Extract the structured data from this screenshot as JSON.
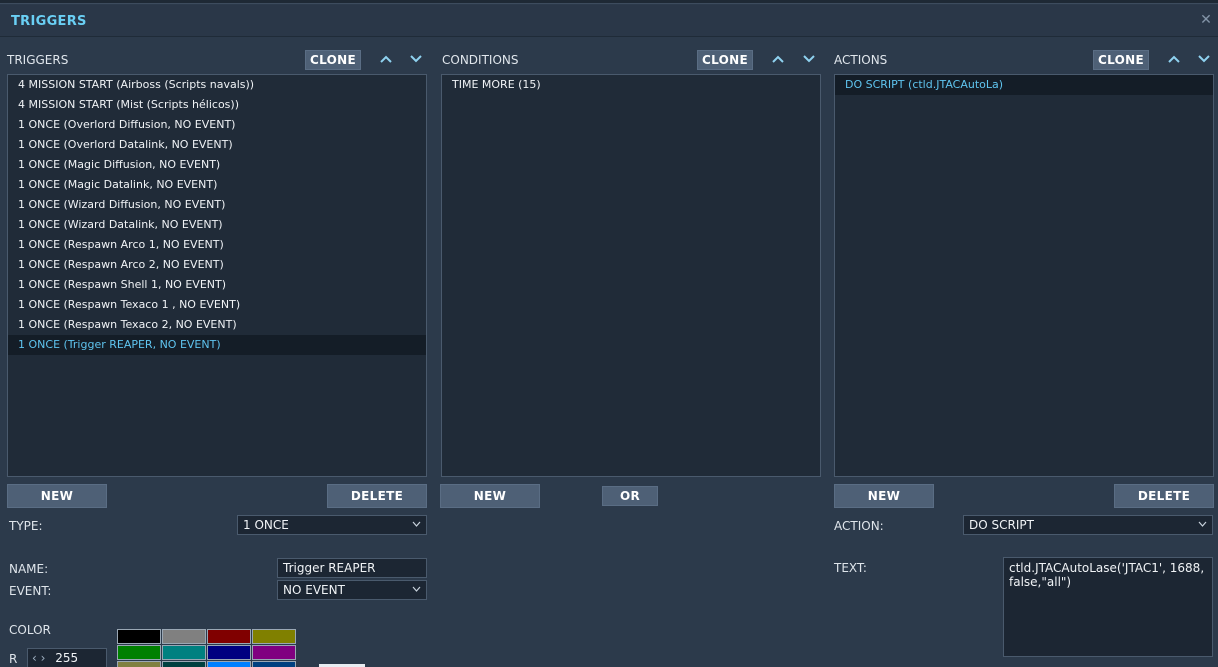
{
  "window": {
    "title": "TRIGGERS"
  },
  "triggers": {
    "label": "TRIGGERS",
    "clone_label": "CLONE",
    "items": [
      "4 MISSION START (Airboss (Scripts navals))",
      "4 MISSION START (Mist (Scripts hélicos))",
      "1 ONCE (Overlord Diffusion, NO EVENT)",
      "1 ONCE (Overlord Datalink, NO EVENT)",
      "1 ONCE (Magic Diffusion, NO EVENT)",
      "1 ONCE (Magic Datalink, NO EVENT)",
      "1 ONCE (Wizard Diffusion, NO EVENT)",
      "1 ONCE (Wizard Datalink, NO EVENT)",
      "1 ONCE (Respawn Arco 1, NO EVENT)",
      "1 ONCE (Respawn Arco 2, NO EVENT)",
      "1 ONCE (Respawn Shell 1, NO EVENT)",
      "1 ONCE (Respawn Texaco 1 , NO EVENT)",
      "1 ONCE (Respawn Texaco 2, NO EVENT)",
      "1 ONCE (Trigger REAPER, NO EVENT)"
    ],
    "new_label": "NEW",
    "delete_label": "DELETE",
    "type_label": "TYPE:",
    "type_value": "1 ONCE",
    "name_label": "NAME:",
    "name_value": "Trigger REAPER",
    "event_label": "EVENT:",
    "event_value": "NO EVENT",
    "color_label": "COLOR",
    "r_label": "R",
    "r_value": "255"
  },
  "conditions": {
    "label": "CONDITIONS",
    "clone_label": "CLONE",
    "items": [
      "TIME MORE (15)"
    ],
    "new_label": "NEW",
    "or_label": "OR"
  },
  "actions": {
    "label": "ACTIONS",
    "clone_label": "CLONE",
    "items": [
      "DO SCRIPT (ctld.JTACAutoLa)"
    ],
    "new_label": "NEW",
    "delete_label": "DELETE",
    "action_label": "ACTION:",
    "action_value": "DO SCRIPT",
    "text_label": "TEXT:",
    "text_value": "ctld.JTACAutoLase('JTAC1', 1688,\nfalse,\"all\")"
  },
  "colors": {
    "accent": "#6ad0f5",
    "selected_text": "#5fc4ef",
    "palette": [
      "#000000",
      "#808080",
      "#800000",
      "#808000",
      "#008000",
      "#008080",
      "#000080",
      "#800080",
      "#808040",
      "#004040",
      "#0080ff",
      "#004080"
    ]
  }
}
